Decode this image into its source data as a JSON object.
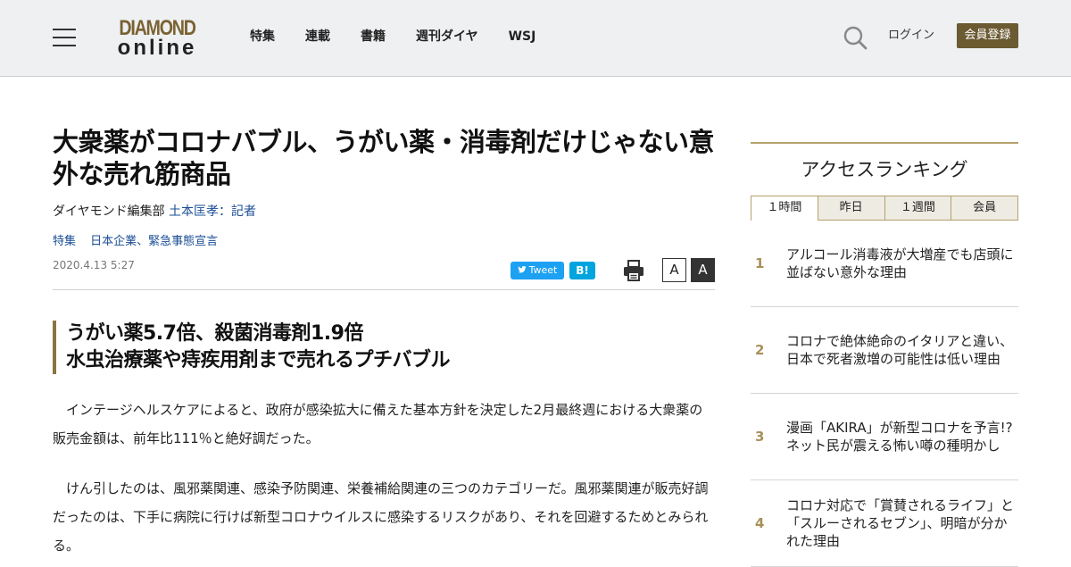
{
  "header": {
    "logo_line1": "DIAMOND",
    "logo_line2": "online",
    "nav": [
      "特集",
      "連載",
      "書籍",
      "週刊ダイヤ",
      "WSJ"
    ],
    "login": "ログイン",
    "register": "会員登録"
  },
  "article": {
    "title": "大衆薬がコロナバブル、うがい薬・消毒剤だけじゃない意外な売れ筋商品",
    "byline_org": "ダイヤモンド編集部",
    "byline_author": "土本匡孝：記者",
    "tags": [
      "特集",
      "日本企業、緊急事態宣言"
    ],
    "date": "2020.4.13 5:27",
    "tweet_label": "Tweet",
    "hatena_label": "B!",
    "font_small": "A",
    "font_large": "A",
    "subhead_line1": "うがい薬5.7倍、殺菌消毒剤1.9倍",
    "subhead_line2": "水虫治療薬や痔疾用剤まで売れるプチバブル",
    "paragraphs": [
      "インテージヘルスケアによると、政府が感染拡大に備えた基本方針を決定した2月最終週における大衆薬の販売金額は、前年比111％と絶好調だった。",
      "けん引したのは、風邪薬関連、感染予防関連、栄養補給関連の三つのカテゴリーだ。風邪薬関連が販売好調だったのは、下手に病院に行けば新型コロナウイルスに感染するリスクがあり、それを回避するためとみられる。"
    ]
  },
  "ranking": {
    "title": "アクセスランキング",
    "tabs": [
      "１時間",
      "昨日",
      "１週間",
      "会員"
    ],
    "active_tab": 0,
    "items": [
      {
        "rank": "1",
        "text": "アルコール消毒液が大増産でも店頭に並ばない意外な理由"
      },
      {
        "rank": "2",
        "text": "コロナで絶体絶命のイタリアと違い、日本で死者激増の可能性は低い理由"
      },
      {
        "rank": "3",
        "text": "漫画「AKIRA」が新型コロナを予言!?ネット民が震える怖い噂の種明かし"
      },
      {
        "rank": "4",
        "text": "コロナ対応で「賞賛されるライフ」と「スルーされるセブン」、明暗が分かれた理由"
      }
    ]
  },
  "colors": {
    "header_bg": "#eef0f2",
    "brand_gold": "#6b5a32",
    "link_blue": "#1a4d94",
    "rank_gold": "#a8915a",
    "tweet_blue": "#1da1f2",
    "hatena_blue": "#00a4de"
  },
  "icons": {
    "menu": "hamburger-icon",
    "search": "search-icon",
    "print": "printer-icon",
    "twitter": "twitter-bird-icon"
  }
}
